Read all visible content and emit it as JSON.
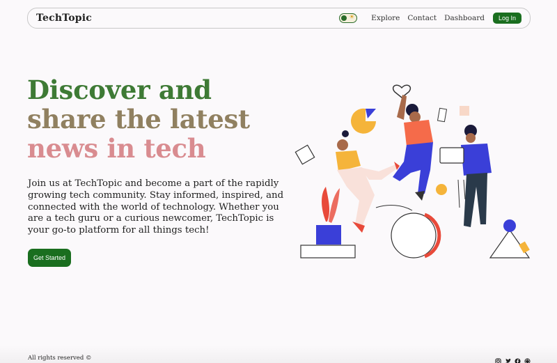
{
  "navbar": {
    "brand": "TechTopic",
    "links": [
      {
        "label": "Explore"
      },
      {
        "label": "Contact"
      },
      {
        "label": "Dashboard"
      }
    ],
    "login_label": "Log In"
  },
  "hero": {
    "title_lines": [
      "Discover and",
      "share the latest",
      "news in tech"
    ],
    "description": "Join us at TechTopic and become a part of the rapidly growing tech community. Stay informed, inspired, and connected with the world of technology. Whether you are a tech guru or a curious newcomer, TechTopic is your go-to platform for all things tech!",
    "cta_label": "Get Started"
  },
  "footer": {
    "copyright": "All rights reserved ©",
    "social_icons": [
      "instagram-icon",
      "twitter-icon",
      "facebook-icon",
      "github-icon"
    ]
  },
  "colors": {
    "primary_green": "#1a6e1f",
    "title_green": "#3e7a35",
    "title_olive": "#908060",
    "title_pink": "#d98c90",
    "background": "#fbf9fb"
  }
}
